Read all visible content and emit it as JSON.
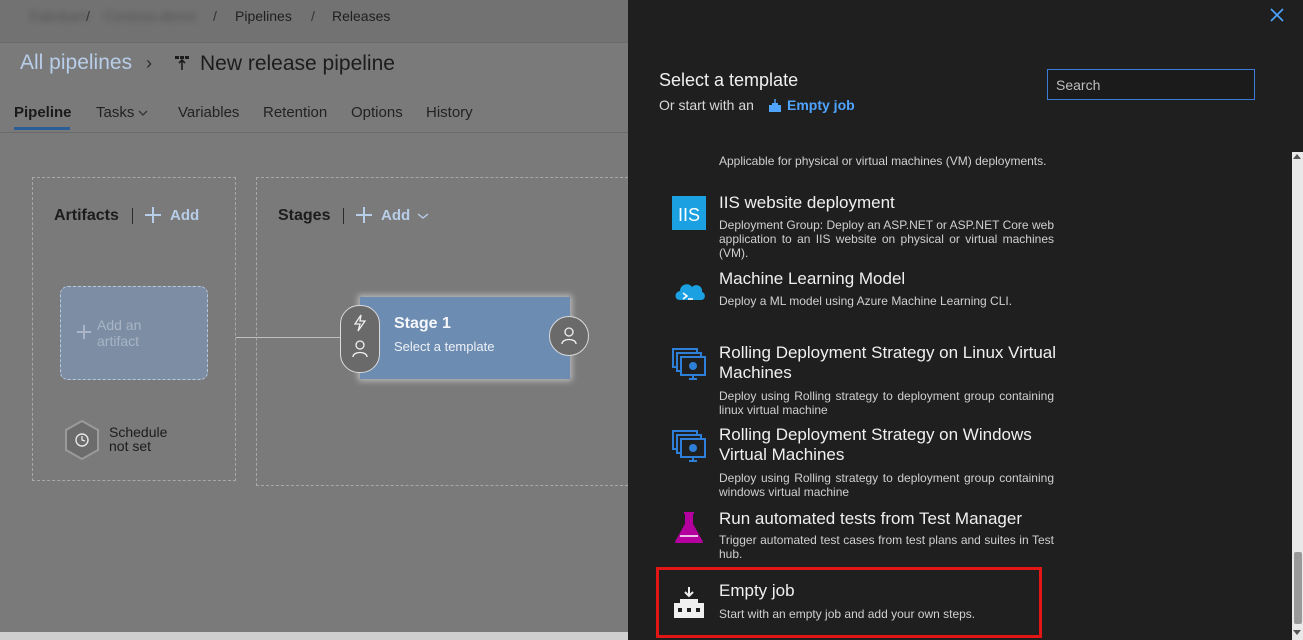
{
  "breadcrumb": {
    "org": "Fabrikam",
    "project": "Contoso-demo",
    "pipelines": "Pipelines",
    "releases": "Releases",
    "separator": "/"
  },
  "header": {
    "all_pipelines": "All pipelines",
    "chevron": "›",
    "pipeline_name": "New release pipeline"
  },
  "tabs": [
    "Pipeline",
    "Tasks",
    "Variables",
    "Retention",
    "Options",
    "History"
  ],
  "canvas": {
    "artifacts_title": "Artifacts",
    "artifacts_add": "Add",
    "artifact_placeholder": "Add an artifact",
    "stages_title": "Stages",
    "stages_add": "Add",
    "stage_name": "Stage 1",
    "stage_sub": "Select a template",
    "schedule": "Schedule not set"
  },
  "panel": {
    "title": "Select a template",
    "subtitle": "Or start with an",
    "empty_job_link": "Empty job",
    "search_placeholder": "Search"
  },
  "templates": [
    {
      "title": "",
      "desc": "Applicable for physical or virtual machines (VM) deployments.",
      "icon": "partial-icon"
    },
    {
      "title": "IIS website deployment",
      "desc": "Deployment Group: Deploy an ASP.NET or ASP.NET Core web application to an IIS website on physical or virtual machines (VM).",
      "icon": "iis-icon"
    },
    {
      "title": "Machine Learning Model",
      "desc": "Deploy a ML model using Azure Machine Learning CLI.",
      "icon": "cloud-icon"
    },
    {
      "title": "Rolling Deployment Strategy on Linux Virtual Machines",
      "desc": "Deploy using Rolling strategy to deployment group containing linux virtual machine",
      "icon": "vm-stack-icon"
    },
    {
      "title": "Rolling Deployment Strategy on Windows Virtual Machines",
      "desc": "Deploy using Rolling strategy to deployment group containing windows virtual machine",
      "icon": "vm-stack-icon"
    },
    {
      "title": "Run automated tests from Test Manager",
      "desc": "Trigger automated test cases from test plans and suites in Test hub.",
      "icon": "flask-icon"
    },
    {
      "title": "Empty job",
      "desc": "Start with an empty job and add your own steps.",
      "icon": "empty-job-icon"
    }
  ],
  "colors": {
    "accent": "#4ea4ff",
    "highlight": "#e31616",
    "panel_bg": "#1f1f1f",
    "dim_bg": "#7a7a7a"
  }
}
